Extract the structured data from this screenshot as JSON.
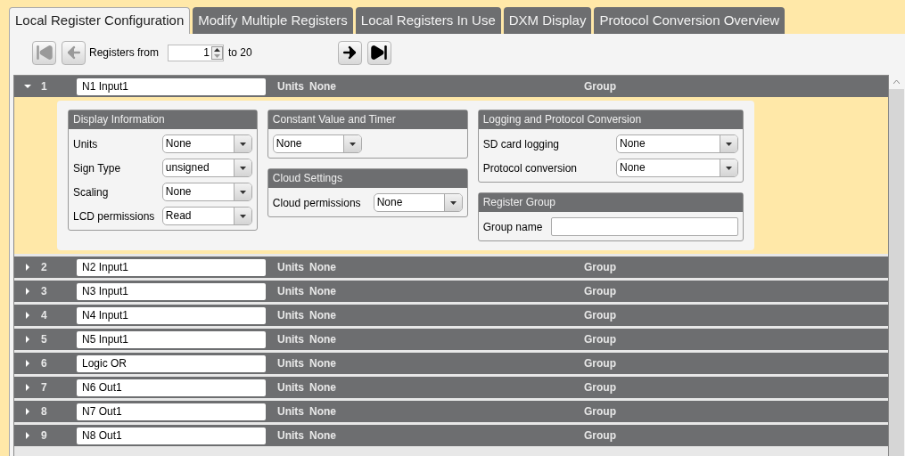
{
  "tabs": [
    {
      "label": "Local Register Configuration",
      "selected": true
    },
    {
      "label": "Modify Multiple Registers",
      "selected": false
    },
    {
      "label": "Local Registers In Use",
      "selected": false
    },
    {
      "label": "DXM Display",
      "selected": false
    },
    {
      "label": "Protocol Conversion Overview",
      "selected": false
    }
  ],
  "toolbar": {
    "first_disabled": true,
    "previous_disabled": true,
    "from_label": "Registers from",
    "from_value": "1",
    "to_label": "to 20",
    "next_disabled": false,
    "last_disabled": false
  },
  "registers": [
    {
      "number": "1",
      "name": "N1 Input1",
      "units_label": "Units",
      "units": "None",
      "group_label": "Group",
      "expanded": true
    },
    {
      "number": "2",
      "name": "N2 Input1",
      "units_label": "Units",
      "units": "None",
      "group_label": "Group",
      "expanded": false
    },
    {
      "number": "3",
      "name": "N3 Input1",
      "units_label": "Units",
      "units": "None",
      "group_label": "Group",
      "expanded": false
    },
    {
      "number": "4",
      "name": "N4 Input1",
      "units_label": "Units",
      "units": "None",
      "group_label": "Group",
      "expanded": false
    },
    {
      "number": "5",
      "name": "N5 Input1",
      "units_label": "Units",
      "units": "None",
      "group_label": "Group",
      "expanded": false
    },
    {
      "number": "6",
      "name": "Logic OR",
      "units_label": "Units",
      "units": "None",
      "group_label": "Group",
      "expanded": false
    },
    {
      "number": "7",
      "name": "N6 Out1",
      "units_label": "Units",
      "units": "None",
      "group_label": "Group",
      "expanded": false
    },
    {
      "number": "8",
      "name": "N7 Out1",
      "units_label": "Units",
      "units": "None",
      "group_label": "Group",
      "expanded": false
    },
    {
      "number": "9",
      "name": "N8 Out1",
      "units_label": "Units",
      "units": "None",
      "group_label": "Group",
      "expanded": false
    }
  ],
  "details": {
    "columns": [
      [
        {
          "title": "Display Information",
          "fields": [
            {
              "kind": "select",
              "label": "Units",
              "value": "None"
            },
            {
              "kind": "select",
              "label": "Sign Type",
              "value": "unsigned"
            },
            {
              "kind": "select",
              "label": "Scaling",
              "value": "None"
            },
            {
              "kind": "select",
              "label": "LCD permissions",
              "value": "Read"
            }
          ]
        }
      ],
      [
        {
          "title": "Constant Value and Timer",
          "fields": [
            {
              "kind": "select",
              "value": "None"
            }
          ]
        },
        {
          "title": "Cloud Settings",
          "fields": [
            {
              "kind": "select",
              "label": "Cloud permissions",
              "value": "None"
            }
          ]
        }
      ],
      [
        {
          "title": "Logging and Protocol Conversion",
          "fields": [
            {
              "kind": "select",
              "label": "SD card logging",
              "value": "None"
            },
            {
              "kind": "select",
              "label": "Protocol conversion",
              "value": "None"
            }
          ]
        },
        {
          "title": "Register Group",
          "fields": [
            {
              "kind": "text",
              "label": "Group name"
            }
          ]
        }
      ]
    ]
  }
}
